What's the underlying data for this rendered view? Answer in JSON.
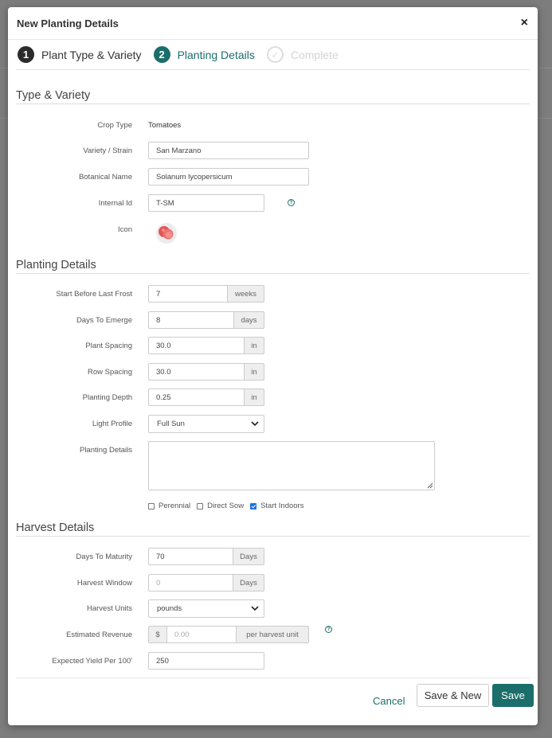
{
  "modal": {
    "title": "New Planting Details",
    "close_glyph": "×"
  },
  "steps": [
    {
      "number": "1",
      "label": "Plant Type & Variety",
      "state": "done"
    },
    {
      "number": "2",
      "label": "Planting Details",
      "state": "active"
    },
    {
      "number": "✓",
      "label": "Complete",
      "state": "todo"
    }
  ],
  "type_variety": {
    "title": "Type & Variety",
    "crop_type": {
      "label": "Crop Type",
      "value": "Tomatoes"
    },
    "variety": {
      "label": "Variety / Strain",
      "value": "San Marzano"
    },
    "botanical": {
      "label": "Botanical Name",
      "value": "Solanum lycopersicum"
    },
    "internal_id": {
      "label": "Internal Id",
      "value": "T-SM"
    },
    "icon": {
      "label": "Icon",
      "icon_name": "tomato-icon"
    }
  },
  "planting": {
    "title": "Planting Details",
    "start_before": {
      "label": "Start Before Last Frost",
      "value": "7",
      "unit": "weeks"
    },
    "days_emerge": {
      "label": "Days To Emerge",
      "value": "8",
      "unit": "days"
    },
    "plant_spacing": {
      "label": "Plant Spacing",
      "value": "30.0",
      "unit": "in"
    },
    "row_spacing": {
      "label": "Row Spacing",
      "value": "30.0",
      "unit": "in"
    },
    "depth": {
      "label": "Planting Depth",
      "value": "0.25",
      "unit": "in"
    },
    "light": {
      "label": "Light Profile",
      "value": "Full Sun"
    },
    "notes": {
      "label": "Planting Details",
      "value": ""
    },
    "checkboxes": [
      {
        "label": "Perennial",
        "checked": false
      },
      {
        "label": "Direct Sow",
        "checked": false
      },
      {
        "label": "Start Indoors",
        "checked": true
      }
    ]
  },
  "harvest": {
    "title": "Harvest Details",
    "maturity": {
      "label": "Days To Maturity",
      "value": "70",
      "unit": "Days"
    },
    "window": {
      "label": "Harvest Window",
      "placeholder": "0",
      "unit": "Days"
    },
    "units": {
      "label": "Harvest Units",
      "value": "pounds"
    },
    "revenue": {
      "label": "Estimated Revenue",
      "prefix": "$",
      "placeholder": "0.00",
      "suffix": "per harvest unit"
    },
    "yield": {
      "label": "Expected Yield Per 100'",
      "value": "250"
    }
  },
  "footer": {
    "cancel": "Cancel",
    "save_new": "Save & New",
    "save": "Save"
  },
  "colors": {
    "accent": "#1b6e6a",
    "checkbox": "#1a73e8"
  }
}
